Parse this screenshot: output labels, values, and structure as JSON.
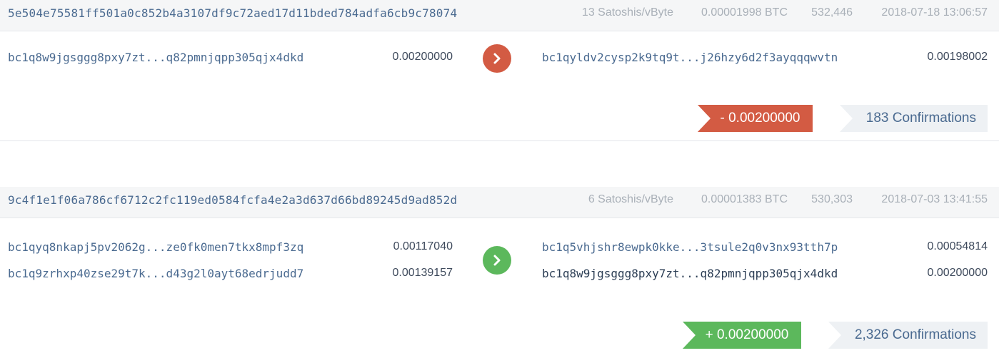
{
  "transactions": [
    {
      "hash": "5e504e75581ff501a0c852b4a3107df9c72aed17d11bded784adfa6cb9c78074",
      "fee_rate": "13 Satoshis/vByte",
      "fee": "0.00001998 BTC",
      "block": "532,446",
      "time": "2018-07-18 13:06:57",
      "inputs": [
        {
          "address": "bc1q8w9jgsggg8pxy7zt...q82pmnjqpp305qjx4dkd",
          "amount": "0.00200000"
        }
      ],
      "outputs": [
        {
          "address": "bc1qyldv2cysp2k9tq9t...j26hzy6d2f3ayqqqwvtn",
          "amount": "0.00198002"
        }
      ],
      "direction": "out",
      "arrow_icon": "chevron-right-icon",
      "arrow_color": "#d35b43",
      "net_amount": "- 0.00200000",
      "confirmations": "183 Confirmations"
    },
    {
      "hash": "9c4f1e1f06a786cf6712c2fc119ed0584fcfa4e2a3d637d66bd89245d9ad852d",
      "fee_rate": "6 Satoshis/vByte",
      "fee": "0.00001383 BTC",
      "block": "530,303",
      "time": "2018-07-03 13:41:55",
      "inputs": [
        {
          "address": "bc1qyq8nkapj5pv2062g...ze0fk0men7tkx8mpf3zq",
          "amount": "0.00117040"
        },
        {
          "address": "bc1q9zrhxp40zse29t7k...d43g2l0ayt68edrjudd7",
          "amount": "0.00139157"
        }
      ],
      "outputs": [
        {
          "address": "bc1q5vhjshr8ewpk0kke...3tsule2q0v3nx93tth7p",
          "amount": "0.00054814"
        },
        {
          "address": "bc1q8w9jgsggg8pxy7zt...q82pmnjqpp305qjx4dkd",
          "amount": "0.00200000"
        }
      ],
      "direction": "in",
      "arrow_icon": "chevron-right-icon",
      "arrow_color": "#5cb85c",
      "net_amount": "+ 0.00200000",
      "confirmations": "2,326 Confirmations"
    }
  ]
}
